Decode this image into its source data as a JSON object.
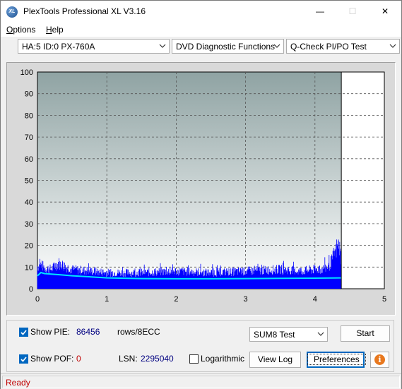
{
  "window": {
    "title": "PlexTools Professional XL V3.16",
    "app_icon_text": "XL",
    "minimize_glyph": "—",
    "maximize_glyph": "☐",
    "close_glyph": "✕"
  },
  "menu": {
    "options_first": "O",
    "options_rest": "ptions",
    "help_first": "H",
    "help_rest": "elp"
  },
  "toolbar": {
    "drive_select": "HA:5 ID:0  PX-760A",
    "function_select": "DVD Diagnostic Functions",
    "test_select": "Q-Check PI/PO Test"
  },
  "chart_data": {
    "type": "area",
    "title": "",
    "xlabel": "",
    "ylabel": "",
    "xlim": [
      0,
      5
    ],
    "ylim": [
      0,
      100
    ],
    "x_ticks": [
      "0",
      "1",
      "2",
      "3",
      "4",
      "5"
    ],
    "y_ticks": [
      "0",
      "10",
      "20",
      "30",
      "40",
      "50",
      "60",
      "70",
      "80",
      "90",
      "100"
    ],
    "grid": true,
    "end_marker_x": 4.38,
    "series": [
      {
        "values_description_x": [
          0,
          0.05,
          0.1,
          0.2,
          0.3,
          0.5,
          0.8,
          1.0,
          1.5,
          2.0,
          2.5,
          3.0,
          3.5,
          3.8,
          4.0,
          4.1,
          4.2,
          4.25,
          4.28,
          4.3,
          4.33,
          4.36,
          4.38
        ],
        "x": [
          0,
          0.05,
          0.1,
          0.2,
          0.3,
          0.5,
          0.8,
          1.0,
          1.5,
          2.0,
          2.5,
          3.0,
          3.5,
          3.8,
          4.0,
          4.1,
          4.2,
          4.25,
          4.28,
          4.3,
          4.33,
          4.36,
          4.38
        ],
        "values": [
          14,
          15,
          13,
          12,
          16,
          12,
          11,
          10,
          10,
          11,
          10,
          11,
          12,
          11,
          12,
          12,
          14,
          18,
          22,
          23,
          28,
          24,
          16
        ],
        "color": "#0000ff"
      },
      {
        "x": [
          0,
          0.05,
          0.1,
          0.3,
          0.5,
          1.0,
          1.5,
          2.0,
          2.5,
          3.0,
          3.5,
          4.0,
          4.38
        ],
        "values": [
          6,
          7.5,
          7,
          6.5,
          6,
          5,
          4.7,
          4.6,
          4.6,
          4.7,
          4.8,
          4.9,
          5
        ],
        "color": "#00e5ff"
      }
    ]
  },
  "controls": {
    "show_pie_label": "Show PIE:",
    "pie_value": "86456",
    "pie_unit": "rows/8ECC",
    "show_pof_label": "Show POF:",
    "pof_value": "0",
    "lsn_label": "LSN:",
    "lsn_value": "2295040",
    "logarithmic_label": "Logarithmic",
    "sum_select": "SUM8 Test",
    "start_button": "Start",
    "view_log_button": "View Log",
    "preferences_button": "Preferences",
    "info_glyph": "i",
    "show_pie_checked": true,
    "show_pof_checked": true,
    "logarithmic_checked": false
  },
  "status": {
    "text": "Ready"
  },
  "colors": {
    "chart_bg_top": "#8fa3a3",
    "chart_bg_bottom": "#ffffff",
    "pie_value_color": "#000080",
    "pof_value_color": "#c00000",
    "status_color": "#c00000",
    "info_button_color": "#e8781e"
  }
}
